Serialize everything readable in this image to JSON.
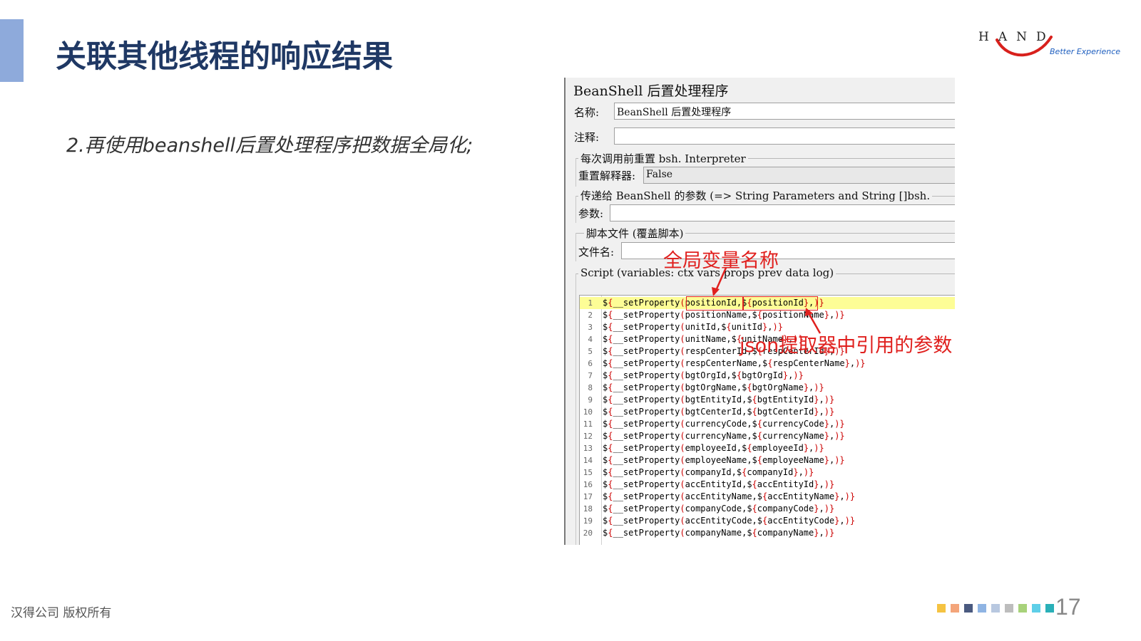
{
  "slide": {
    "title": "关联其他线程的响应结果",
    "subtitle": "2.再使用beanshell后置处理程序把数据全局化;",
    "logo_text": "HAND",
    "logo_tagline": "Better Experience",
    "footer": "汉得公司 版权所有",
    "page_number": "17",
    "accent_color": "#8eaadb",
    "title_color": "#1f3864",
    "footer_dot_colors": [
      "#f5c342",
      "#f4a57a",
      "#4a5a80",
      "#8fb4e3",
      "#b8c8e0",
      "#bdbdbd",
      "#a8d27a",
      "#5ecfe8",
      "#2ab0b8"
    ]
  },
  "panel": {
    "title": "BeanShell 后置处理程序",
    "name_label": "名称:",
    "name_value": "BeanShell 后置处理程序",
    "comment_label": "注释:",
    "comment_value": "",
    "reset_group_legend": "每次调用前重置 bsh. Interpreter",
    "reset_label": "重置解释器:",
    "reset_value": "False",
    "params_group_legend": "传递给 BeanShell 的参数 (=> String Parameters and String []bsh.",
    "params_label": "参数:",
    "params_value": "",
    "file_group_legend": "脚本文件 (覆盖脚本)",
    "file_label": "文件名:",
    "file_value": "",
    "script_group_legend": "Script (variables: ctx vars props prev data log)"
  },
  "script_lines": [
    {
      "n": "1",
      "name": "positionId"
    },
    {
      "n": "2",
      "name": "positionName"
    },
    {
      "n": "3",
      "name": "unitId"
    },
    {
      "n": "4",
      "name": "unitName"
    },
    {
      "n": "5",
      "name": "respCenterId"
    },
    {
      "n": "6",
      "name": "respCenterName"
    },
    {
      "n": "7",
      "name": "bgtOrgId"
    },
    {
      "n": "8",
      "name": "bgtOrgName"
    },
    {
      "n": "9",
      "name": "bgtEntityId"
    },
    {
      "n": "10",
      "name": "bgtCenterId"
    },
    {
      "n": "11",
      "name": "currencyCode"
    },
    {
      "n": "12",
      "name": "currencyName"
    },
    {
      "n": "13",
      "name": "employeeId"
    },
    {
      "n": "14",
      "name": "employeeName"
    },
    {
      "n": "15",
      "name": "companyId"
    },
    {
      "n": "16",
      "name": "accEntityId"
    },
    {
      "n": "17",
      "name": "accEntityName"
    },
    {
      "n": "18",
      "name": "companyCode"
    },
    {
      "n": "19",
      "name": "accEntityCode"
    },
    {
      "n": "20",
      "name": "companyName"
    }
  ],
  "annotations": {
    "global_var": "全局变量名称",
    "json_param": "json提取器中引用的参数",
    "color": "#e0201e"
  }
}
